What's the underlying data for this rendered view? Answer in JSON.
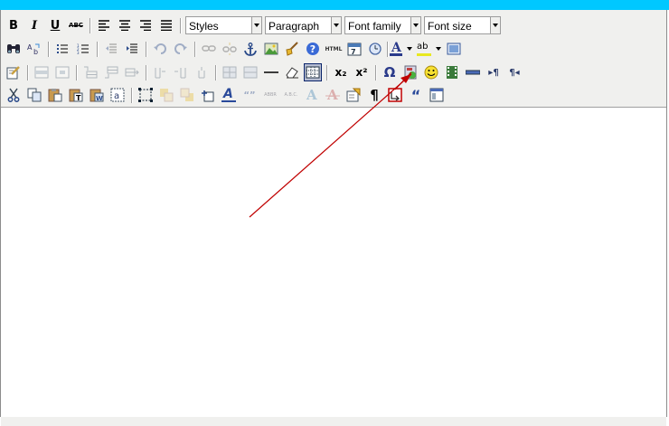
{
  "toolbar": {
    "bold_label": "B",
    "italic_label": "I",
    "underline_label": "U",
    "strikethrough_label": "ABC",
    "styles_value": "Styles",
    "format_value": "Paragraph",
    "font_family_value": "Font family",
    "font_size_value": "Font size",
    "html_label": "HTML",
    "abbr_label": "ABBR",
    "acronym_label": "A.B.C.",
    "cite_label": "“”",
    "forecolor_label": "A",
    "backcolor_label": "ab",
    "subscript_label": "x₂",
    "superscript_label": "x²",
    "omega_label": "Ω",
    "pilcrow_label": "¶",
    "ltr_label": "▸¶",
    "rtl_label": "¶◂",
    "quote_label": "“",
    "style_props_label": "A"
  },
  "colors": {
    "top_bar": "#00c8ff",
    "toolbar_bg": "#f0f0ee",
    "annotation_arrow": "#c00000"
  }
}
